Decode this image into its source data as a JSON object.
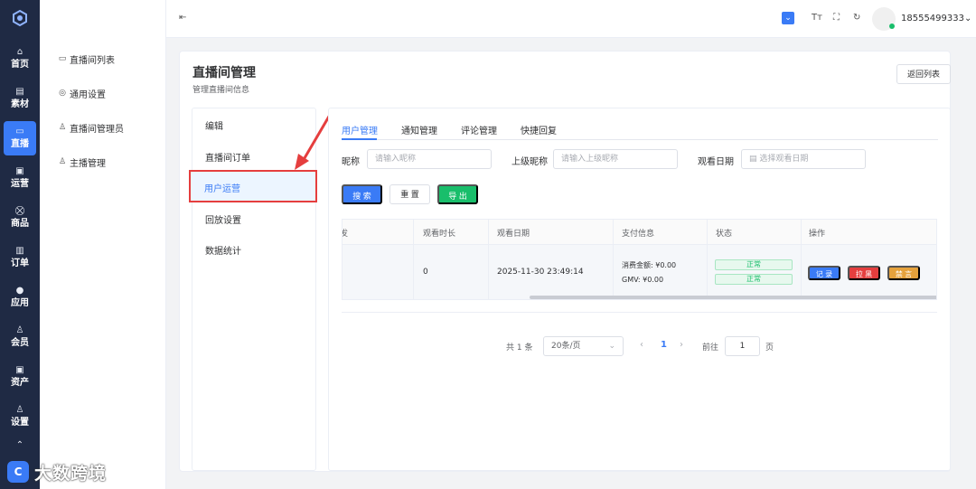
{
  "rail": {
    "items": [
      {
        "icon": "⌂",
        "label": "首页"
      },
      {
        "icon": "▤",
        "label": "素材"
      },
      {
        "icon": "▭",
        "label": "直播"
      },
      {
        "icon": "▣",
        "label": "运营"
      },
      {
        "icon": "⛒",
        "label": "商品"
      },
      {
        "icon": "▥",
        "label": "订单"
      },
      {
        "icon": "●",
        "label": "应用"
      },
      {
        "icon": "♙",
        "label": "会员"
      },
      {
        "icon": "▣",
        "label": "资产"
      },
      {
        "icon": "♙",
        "label": "设置"
      }
    ],
    "active_index": 2
  },
  "submenu": {
    "items": [
      {
        "icon": "▭",
        "label": "直播间列表"
      },
      {
        "icon": "◎",
        "label": "通用设置"
      },
      {
        "icon": "♙",
        "label": "直播间管理员"
      },
      {
        "icon": "♙",
        "label": "主播管理"
      }
    ]
  },
  "header": {
    "user": "18555499333",
    "user_chevron": "⌄"
  },
  "page": {
    "title": "直播间管理",
    "subtitle": "管理直播间信息",
    "back_label": "返回列表"
  },
  "inner_menu": {
    "items": [
      "编辑",
      "直播间订单",
      "用户运营",
      "回放设置",
      "数据统计"
    ],
    "active": "用户运营"
  },
  "tabs": [
    "用户管理",
    "通知管理",
    "评论管理",
    "快捷回复"
  ],
  "filters": {
    "nickname_label": "昵称",
    "nickname_placeholder": "请输入昵称",
    "parent_label": "上级昵称",
    "parent_placeholder": "请输入上级昵称",
    "date_label": "观看日期",
    "date_placeholder": "选择观看日期"
  },
  "actions": {
    "search": "搜 索",
    "reset": "重 置",
    "export": "导 出"
  },
  "table": {
    "headers": [
      "观看时长",
      "观看日期",
      "支付信息",
      "状态",
      "操作"
    ],
    "row": {
      "duration": "0",
      "date": "2025-11-30 23:49:14",
      "pay_amount": "消费金额: ¥0.00",
      "pay_gmv": "GMV: ¥0.00",
      "status1": "正常",
      "status2": "正常",
      "op_record": "记 录",
      "op_block": "拉 黑",
      "op_mute": "禁 言"
    }
  },
  "pagination": {
    "total": "共 1 条",
    "page_size": "20条/页",
    "prev": "‹",
    "current": "1",
    "next": "›",
    "goto_label": "前往",
    "goto_value": "1",
    "page_unit": "页"
  },
  "watermark": {
    "text": "大数跨境"
  },
  "colors": {
    "primary": "#3a7bf6",
    "danger": "#e53e3e",
    "warning": "#e6a23c",
    "success": "#19be6b",
    "rail_bg": "#1f2a44"
  }
}
